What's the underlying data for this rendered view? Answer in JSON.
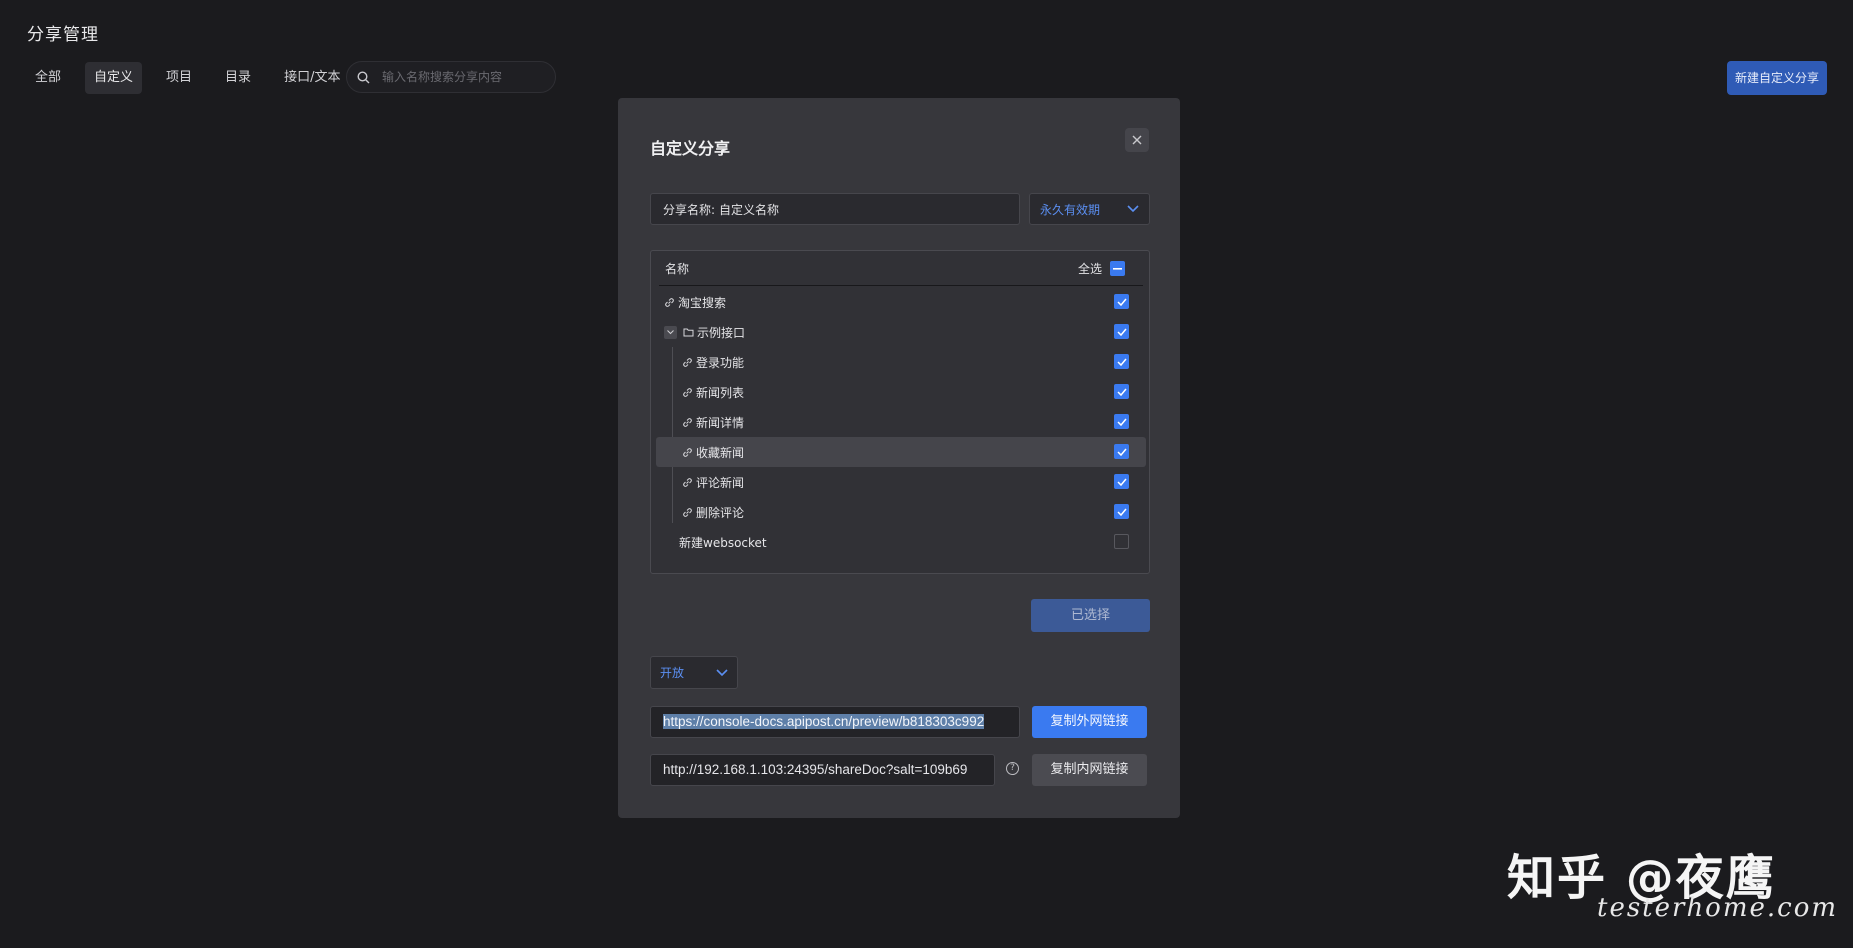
{
  "page": {
    "title": "分享管理"
  },
  "filter_tabs": [
    {
      "label": "全部",
      "active": false
    },
    {
      "label": "自定义",
      "active": true
    },
    {
      "label": "项目",
      "active": false
    },
    {
      "label": "目录",
      "active": false
    },
    {
      "label": "接口/文本",
      "active": false
    }
  ],
  "search": {
    "placeholder": "输入名称搜索分享内容",
    "value": ""
  },
  "header_actions": {
    "new_share_label": "新建自定义分享"
  },
  "modal": {
    "title": "自定义分享",
    "close_icon": "close-icon",
    "name_field": {
      "label": "分享名称:",
      "value": "自定义名称"
    },
    "expiry_select": {
      "value": "永久有效期"
    },
    "tree": {
      "header_name": "名称",
      "header_select_all": "全选",
      "select_all_state": "indeterminate",
      "rows": [
        {
          "label": "淘宝搜索",
          "icon": "link-icon",
          "level": 0,
          "checked": true
        },
        {
          "label": "示例接口",
          "icon": "folder-icon",
          "level": 0,
          "checked": true,
          "expanded": true
        },
        {
          "label": "登录功能",
          "icon": "link-icon",
          "level": 1,
          "checked": true
        },
        {
          "label": "新闻列表",
          "icon": "link-icon",
          "level": 1,
          "checked": true
        },
        {
          "label": "新闻详情",
          "icon": "link-icon",
          "level": 1,
          "checked": true
        },
        {
          "label": "收藏新闻",
          "icon": "link-icon",
          "level": 1,
          "checked": true,
          "hover": true
        },
        {
          "label": "评论新闻",
          "icon": "link-icon",
          "level": 1,
          "checked": true
        },
        {
          "label": "删除评论",
          "icon": "link-icon",
          "level": 1,
          "checked": true
        },
        {
          "label": "新建websocket",
          "icon": "",
          "level": 0,
          "checked": false
        }
      ]
    },
    "selected_button": "已选择",
    "access_select": {
      "value": "开放"
    },
    "external_link": "https://console-docs.apipost.cn/preview/b818303c992",
    "copy_external_label": "复制外网链接",
    "internal_link": "http://192.168.1.103:24395/shareDoc?salt=109b69",
    "help_icon": "question-circle-icon",
    "help_glyph": "?",
    "copy_internal_label": "复制内网链接"
  },
  "watermark": {
    "main": "知乎 @夜鹰",
    "sub": "testerhome.com"
  },
  "colors": {
    "accent": "#3a7af0",
    "background": "#1b1b1e",
    "modal": "#37373c"
  }
}
